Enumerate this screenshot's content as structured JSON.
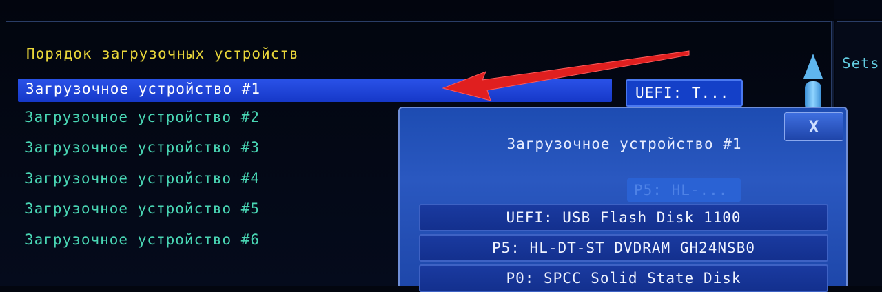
{
  "section_title": "Порядок загрузочных устройств",
  "boot_devices": [
    {
      "label": "Загрузочное устройство #1"
    },
    {
      "label": "Загрузочное устройство #2"
    },
    {
      "label": "Загрузочное устройство #3"
    },
    {
      "label": "Загрузочное устройство #4"
    },
    {
      "label": "Загрузочное устройство #5"
    },
    {
      "label": "Загрузочное устройство #6"
    }
  ],
  "selected_value": "UEFI: T...",
  "help_text": "Sets",
  "popup": {
    "title": "Загрузочное устройство #1",
    "close_label": "X",
    "ghost_value": "P5: HL-...",
    "options": [
      {
        "label": "UEFI: USB Flash Disk 1100"
      },
      {
        "label": "P5: HL-DT-ST DVDRAM GH24NSB0"
      },
      {
        "label": "P0: SPCC Solid State Disk"
      }
    ]
  },
  "colors": {
    "selected_row": "#1f44d8",
    "title_yellow": "#e9d63a",
    "item_teal": "#49d6b4",
    "annotation_arrow": "#e01f1f"
  }
}
